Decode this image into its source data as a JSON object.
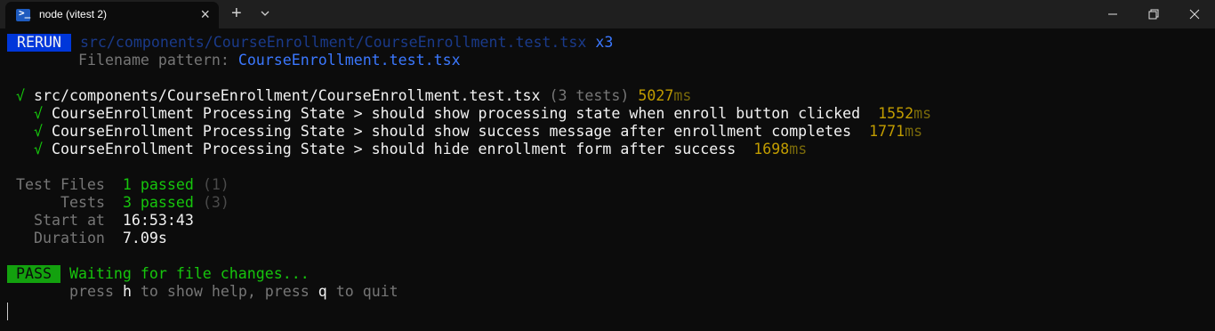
{
  "tab": {
    "title": "node (vitest 2)",
    "icon": "powershell-icon"
  },
  "rerun": {
    "badge": " RERUN ",
    "path": "src/components/CourseEnrollment/CourseEnrollment.test.tsx",
    "count": "x3",
    "pattern_label": "Filename pattern: ",
    "pattern_value": "CourseEnrollment.test.tsx"
  },
  "suite": {
    "check": "√",
    "file": "src/components/CourseEnrollment/CourseEnrollment.test.tsx",
    "tests": "(3 tests)",
    "time": "5027",
    "unit": "ms"
  },
  "tests": [
    {
      "check": "√",
      "name": "CourseEnrollment Processing State > should show processing state when enroll button clicked",
      "time": "1552",
      "unit": "ms"
    },
    {
      "check": "√",
      "name": "CourseEnrollment Processing State > should show success message after enrollment completes",
      "time": "1771",
      "unit": "ms"
    },
    {
      "check": "√",
      "name": "CourseEnrollment Processing State > should hide enrollment form after success",
      "time": "1698",
      "unit": "ms"
    }
  ],
  "summary": {
    "files_label": "Test Files",
    "files_value": "1 passed",
    "files_count": "(1)",
    "tests_label": "Tests",
    "tests_value": "3 passed",
    "tests_count": "(3)",
    "start_label": "Start at",
    "start_value": "16:53:43",
    "duration_label": "Duration",
    "duration_value": "7.09s"
  },
  "status": {
    "badge": " PASS ",
    "message": "Waiting for file changes...",
    "help_press1": "press ",
    "help_key1": "h",
    "help_text1": " to show help, press ",
    "help_key2": "q",
    "help_text2": " to quit"
  },
  "colors": {
    "background": "#0c0c0c",
    "green": "#16c60c",
    "blue": "#3b78ff",
    "yellow": "#c19c00",
    "rerun_bg": "#0037da",
    "pass_bg": "#13a10e"
  }
}
